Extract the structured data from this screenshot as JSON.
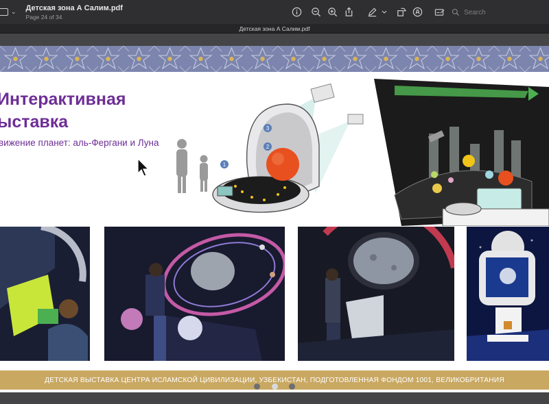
{
  "window": {
    "doc_name": "Детская зона А Салим.pdf",
    "page_info": "Page 24 of 34",
    "tab_title": "Детская зона А Салим.pdf"
  },
  "search": {
    "placeholder": "Search"
  },
  "toolbar": {
    "icons": [
      "sidebar-icon",
      "info-icon",
      "zoom-out-icon",
      "zoom-in-icon",
      "share-icon",
      "markup-pen-icon",
      "rotate-icon",
      "highlight-circle-icon",
      "annotate-icon",
      "search-icon"
    ]
  },
  "slide": {
    "heading_line1": "Интерактивная",
    "heading_line2": "ыставка",
    "subheading": "вижение планет: аль-Фергани и Луна",
    "diagram_labels": [
      "1",
      "2",
      "3"
    ],
    "footer": "ДЕТСКАЯ ВЫСТАВКА ЦЕНТРА ИСЛАМСКОЙ ЦИВИЛИЗАЦИИ, УЗБЕКИСТАН, ПОДГОТОВЛЕННАЯ ФОНДОМ 1001, ВЕЛИКОБРИТАНИЯ",
    "accent": "#6d2e96",
    "band": "#c9a862"
  },
  "pagination": {
    "count": 3,
    "active": 2
  }
}
